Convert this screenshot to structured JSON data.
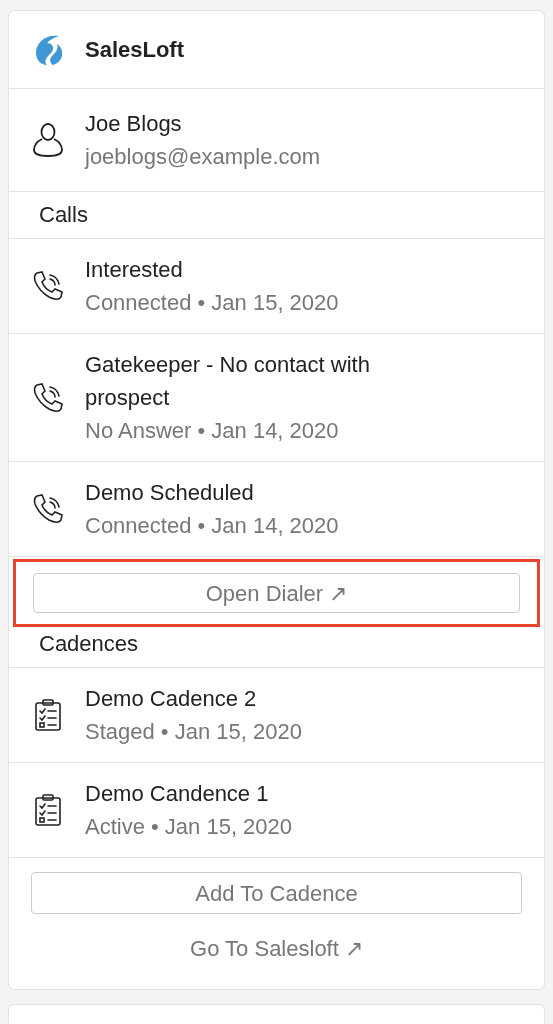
{
  "app": {
    "name": "SalesLoft"
  },
  "contact": {
    "name": "Joe Blogs",
    "email": "joeblogs@example.com"
  },
  "calls": {
    "heading": "Calls",
    "items": [
      {
        "title": "Interested",
        "meta": "Connected • Jan 15, 2020"
      },
      {
        "title": "Gatekeeper - No contact with prospect",
        "meta": "No Answer • Jan 14, 2020"
      },
      {
        "title": "Demo Scheduled",
        "meta": "Connected • Jan 14, 2020"
      }
    ],
    "button": {
      "label": "Open Dialer",
      "arrow": "↗",
      "highlighted": true
    }
  },
  "cadences": {
    "heading": "Cadences",
    "items": [
      {
        "title": "Demo Cadence 2",
        "meta": "Staged • Jan 15, 2020"
      },
      {
        "title": "Demo Candence 1",
        "meta": "Active • Jan 15, 2020"
      }
    ]
  },
  "footer": {
    "button": "Add To Cadence",
    "link": "Go To Salesloft",
    "link_arrow": "↗"
  }
}
